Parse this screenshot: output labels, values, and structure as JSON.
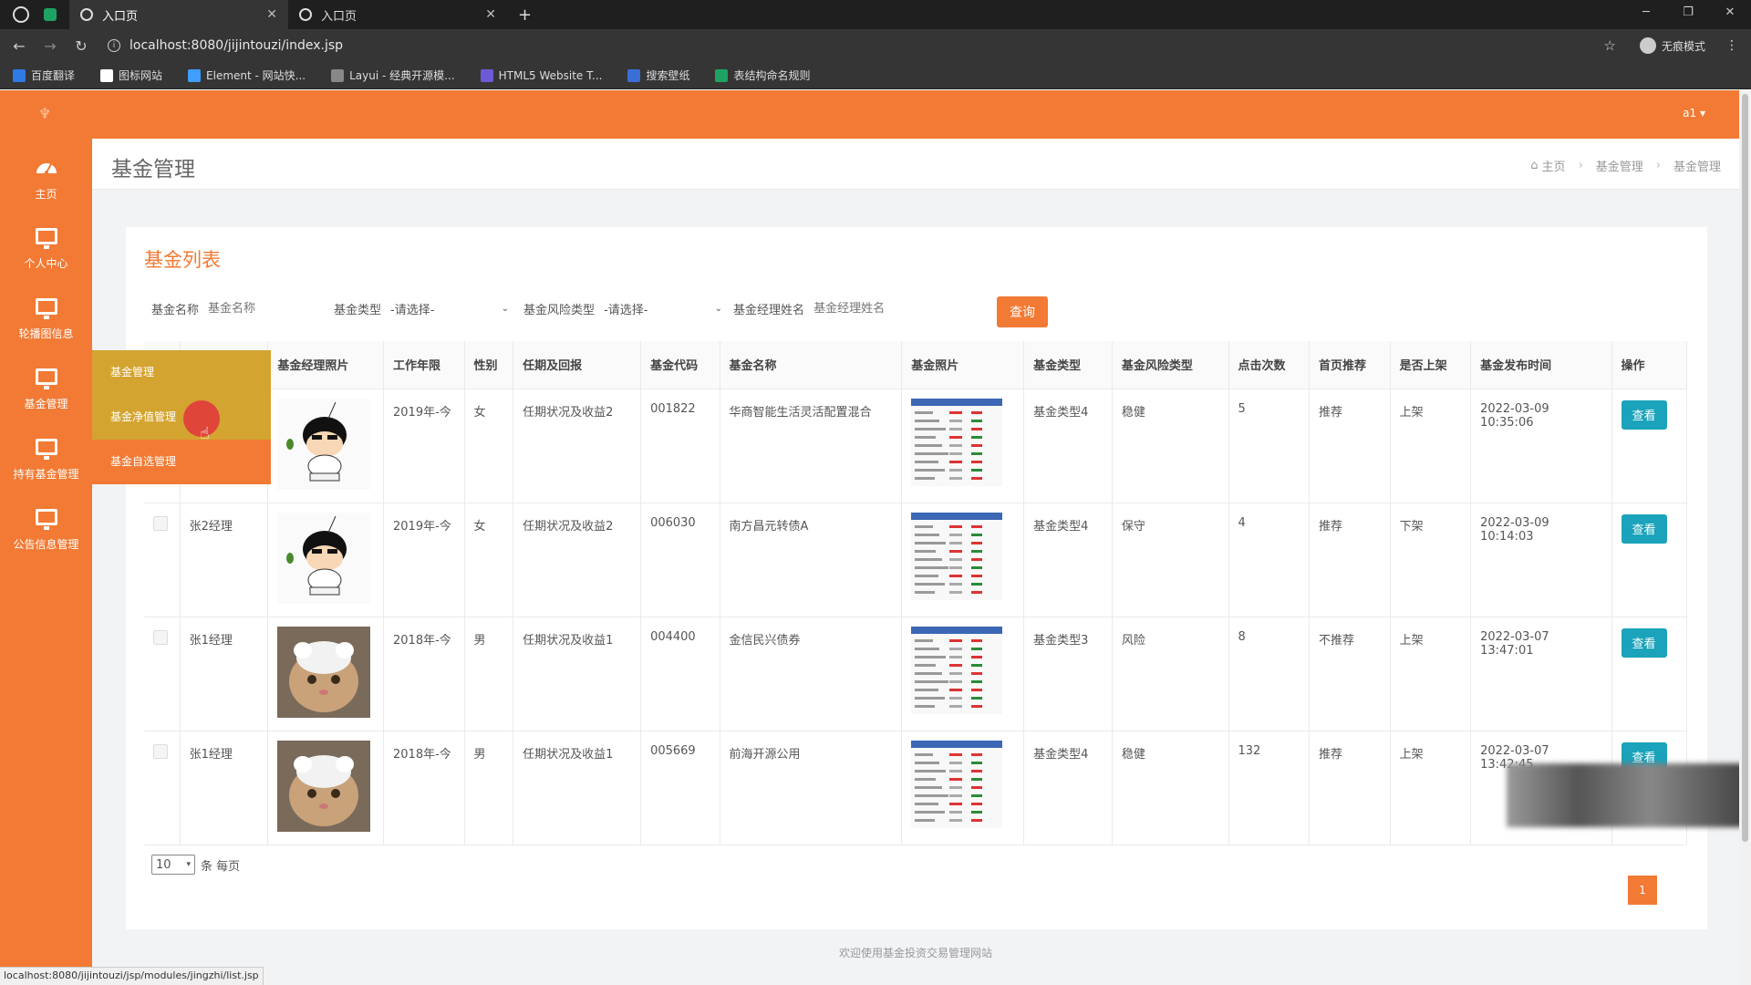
{
  "browser": {
    "tabs": [
      {
        "label": "入口页",
        "active": true
      },
      {
        "label": "入口页",
        "active": false
      }
    ],
    "url": "localhost:8080/jijintouzi/index.jsp",
    "incognito_label": "无痕模式",
    "bookmarks": [
      {
        "label": "百度翻译",
        "color": "#2f7ae5"
      },
      {
        "label": "图标网站",
        "color": "#ffffff"
      },
      {
        "label": "Element - 网站快...",
        "color": "#409eff"
      },
      {
        "label": "Layui - 经典开源模...",
        "color": "#888888"
      },
      {
        "label": "HTML5 Website T...",
        "color": "#6b5bd6"
      },
      {
        "label": "搜索壁纸",
        "color": "#3a6fd8"
      },
      {
        "label": "表结构命名规则",
        "color": "#1ea362"
      }
    ],
    "status_url": "localhost:8080/jijintouzi/jsp/modules/jingzhi/list.jsp"
  },
  "app": {
    "user": "a1 ▾",
    "sidebar": [
      {
        "label": "主页",
        "icon": "dashboard-icon"
      },
      {
        "label": "个人中心",
        "icon": "monitor-icon"
      },
      {
        "label": "轮播图信息",
        "icon": "monitor-icon"
      },
      {
        "label": "基金管理",
        "icon": "monitor-icon"
      },
      {
        "label": "持有基金管理",
        "icon": "monitor-icon"
      },
      {
        "label": "公告信息管理",
        "icon": "monitor-icon"
      }
    ],
    "submenu": [
      "基金管理",
      "基金净值管理",
      "基金自选管理"
    ],
    "page_title": "基金管理",
    "breadcrumb": [
      "主页",
      "基金管理",
      "基金管理"
    ],
    "card_title": "基金列表",
    "search": {
      "name_label": "基金名称",
      "name_placeholder": "基金名称",
      "type_label": "基金类型",
      "type_value": "-请选择-",
      "risk_label": "基金风险类型",
      "risk_value": "-请选择-",
      "manager_label": "基金经理姓名",
      "manager_placeholder": "基金经理姓名",
      "query_label": "查询"
    },
    "table": {
      "headers": [
        "",
        "",
        "基金经理照片",
        "工作年限",
        "性别",
        "任期及回报",
        "基金代码",
        "基金名称",
        "基金照片",
        "基金类型",
        "基金风险类型",
        "点击次数",
        "首页推荐",
        "是否上架",
        "基金发布时间",
        "操作"
      ],
      "rows": [
        {
          "manager": "",
          "photo": "cartoon",
          "years": "2019年-今",
          "gender": "女",
          "tenure": "任期状况及收益2",
          "code": "001822",
          "name": "华商智能生活灵活配置混合",
          "type": "基金类型4",
          "risk": "稳健",
          "clicks": "5",
          "recommend": "推荐",
          "listed": "上架",
          "time": "2022-03-09 10:35:06",
          "action": "查看"
        },
        {
          "manager": "张2经理",
          "photo": "cartoon",
          "years": "2019年-今",
          "gender": "女",
          "tenure": "任期状况及收益2",
          "code": "006030",
          "name": "南方昌元转债A",
          "type": "基金类型4",
          "risk": "保守",
          "clicks": "4",
          "recommend": "推荐",
          "listed": "下架",
          "time": "2022-03-09 10:14:03",
          "action": "查看"
        },
        {
          "manager": "张1经理",
          "photo": "cat",
          "years": "2018年-今",
          "gender": "男",
          "tenure": "任期状况及收益1",
          "code": "004400",
          "name": "金信民兴债券",
          "type": "基金类型3",
          "risk": "风险",
          "clicks": "8",
          "recommend": "不推荐",
          "listed": "上架",
          "time": "2022-03-07 13:47:01",
          "action": "查看"
        },
        {
          "manager": "张1经理",
          "photo": "cat",
          "years": "2018年-今",
          "gender": "男",
          "tenure": "任期状况及收益1",
          "code": "005669",
          "name": "前海开源公用",
          "type": "基金类型4",
          "risk": "稳健",
          "clicks": "132",
          "recommend": "推荐",
          "listed": "上架",
          "time": "2022-03-07 13:42:45",
          "action": "查看"
        }
      ]
    },
    "pager": {
      "page_size": "10",
      "per_page_label": "条 每页",
      "current_page": "1"
    },
    "footer": "欢迎使用基金投资交易管理网站",
    "colors": {
      "accent": "#f27a34",
      "highlight": "#d4a431",
      "view_button": "#1aa3ba"
    }
  }
}
